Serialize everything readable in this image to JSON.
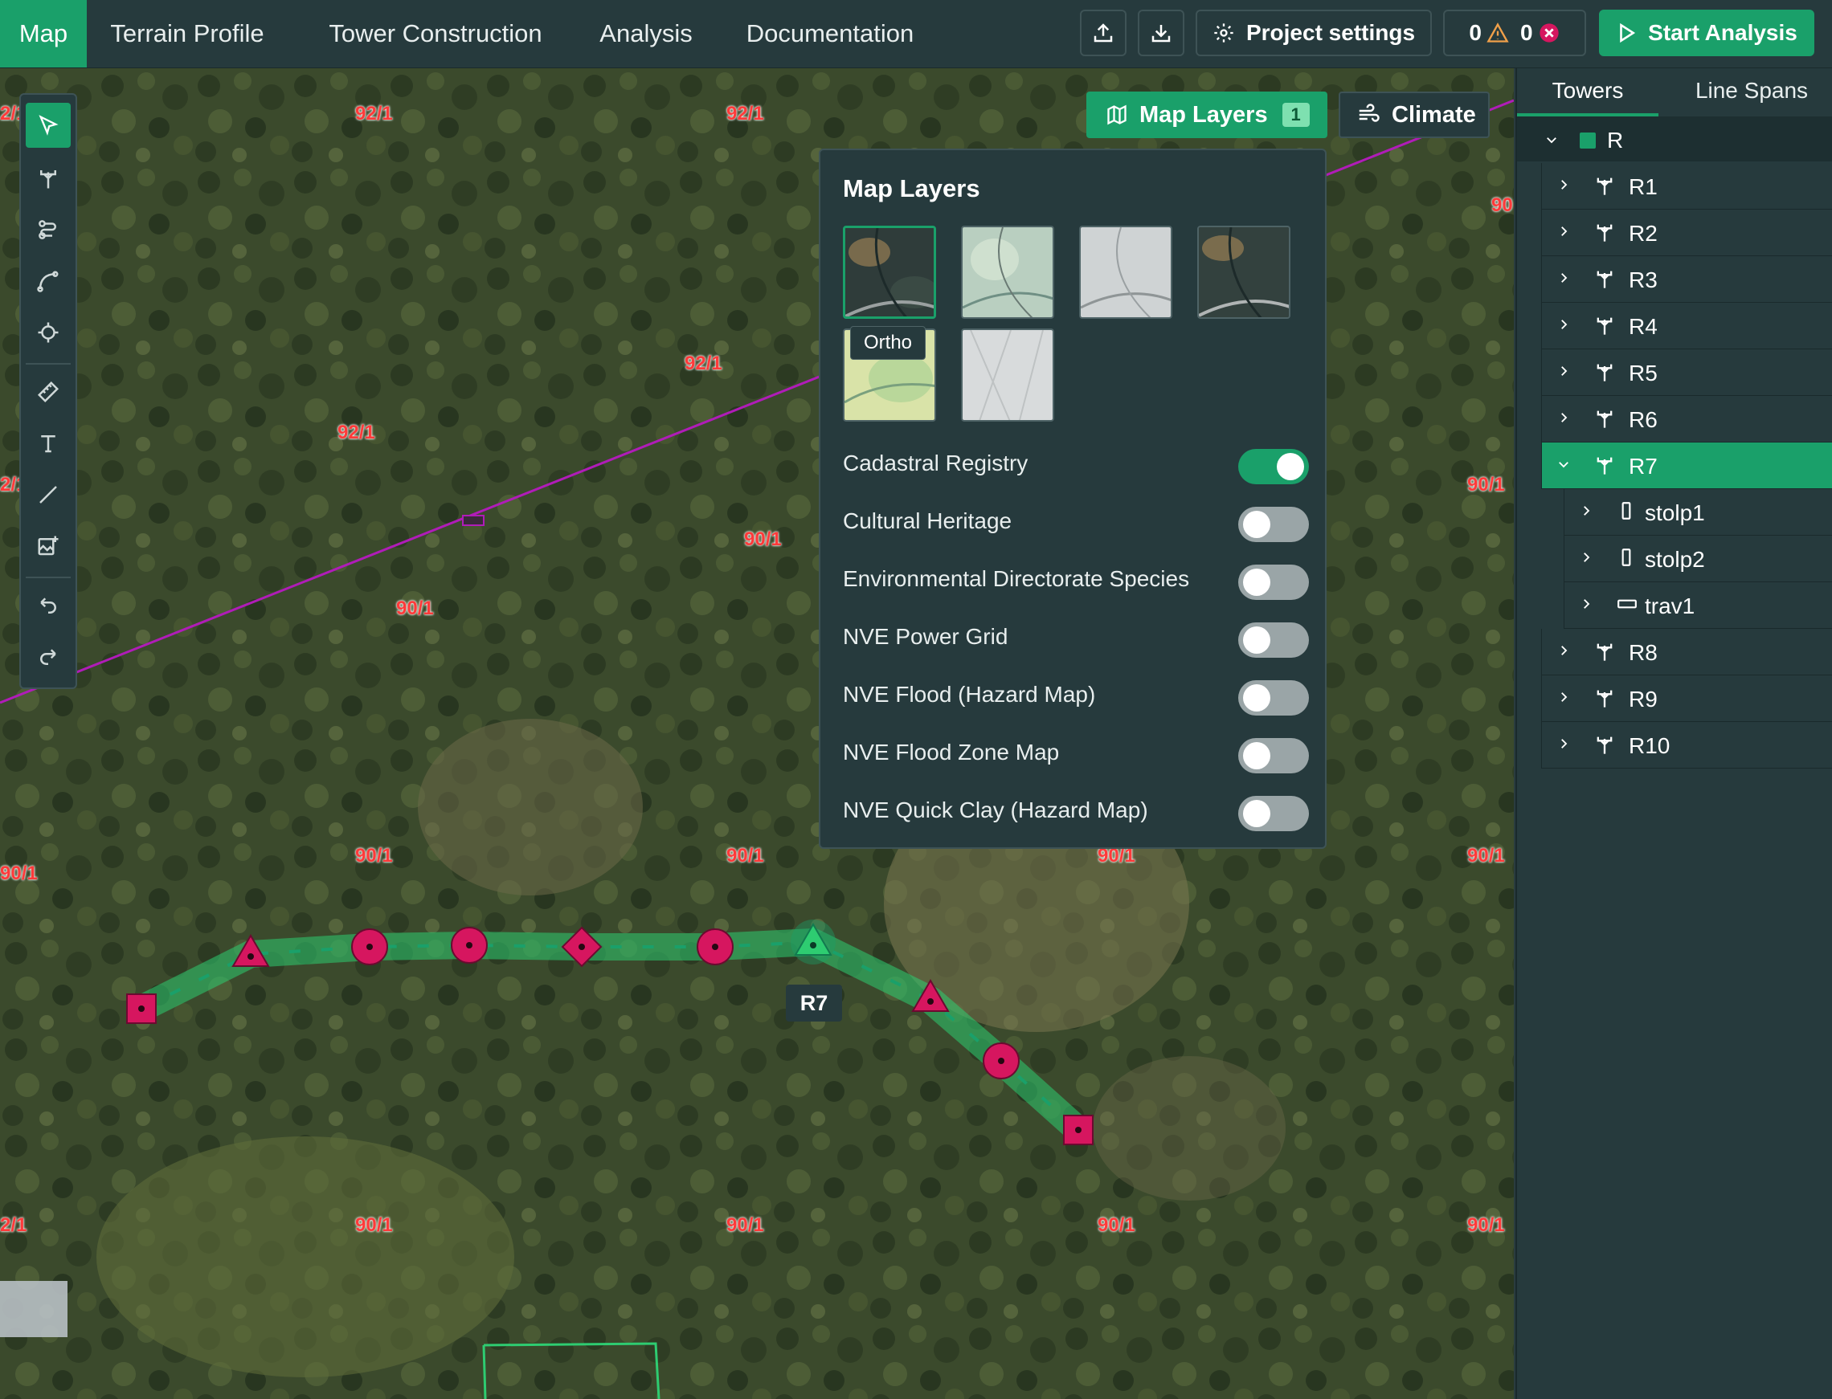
{
  "nav": {
    "tabs": [
      {
        "label": "Map",
        "active": true
      },
      {
        "label": "Terrain Profile",
        "active": false
      },
      {
        "label": "Tower Construction",
        "active": false
      },
      {
        "label": "Analysis",
        "active": false
      },
      {
        "label": "Documentation",
        "active": false
      }
    ]
  },
  "toolbar": {
    "upload_icon": "upload-icon",
    "download_icon": "download-icon",
    "project_settings_label": "Project settings",
    "warnings_count": "0",
    "errors_count": "0",
    "start_analysis_label": "Start Analysis"
  },
  "map_controls": {
    "layers_label": "Map Layers",
    "layers_badge": "1",
    "climate_label": "Climate"
  },
  "layers_panel": {
    "title": "Map Layers",
    "hover_tooltip": "Ortho",
    "layers": [
      {
        "label": "Cadastral Registry",
        "enabled": true
      },
      {
        "label": "Cultural Heritage",
        "enabled": false
      },
      {
        "label": "Environmental Directorate Species",
        "enabled": false
      },
      {
        "label": "NVE Power Grid",
        "enabled": false
      },
      {
        "label": "NVE Flood (Hazard Map)",
        "enabled": false
      },
      {
        "label": "NVE Flood Zone Map",
        "enabled": false
      },
      {
        "label": "NVE Quick Clay (Hazard Map)",
        "enabled": false
      }
    ]
  },
  "map": {
    "parcel_labels": [
      "92/1",
      "92/1",
      "92/1",
      "92/1",
      "90/1",
      "90/1",
      "90/1",
      "90/1",
      "90/1",
      "90/1",
      "90/1",
      "90/1",
      "90/1",
      "90/1",
      "90/1",
      "90/1",
      "90/1",
      "90/1",
      "90/1",
      "90/1"
    ],
    "edge_labels": [
      "2/1",
      "2/1",
      "90/1",
      "90",
      "90/1"
    ],
    "selected_tower_label": "R7"
  },
  "right_panel": {
    "tabs": [
      {
        "label": "Towers",
        "active": true
      },
      {
        "label": "Line Spans",
        "active": false
      }
    ],
    "root": {
      "label": "R",
      "color": "#1aa06a"
    },
    "towers": [
      {
        "label": "R1"
      },
      {
        "label": "R2"
      },
      {
        "label": "R3"
      },
      {
        "label": "R4"
      },
      {
        "label": "R5"
      },
      {
        "label": "R6"
      },
      {
        "label": "R7",
        "selected": true,
        "children": [
          {
            "label": "stolp1",
            "icon": "pole-icon"
          },
          {
            "label": "stolp2",
            "icon": "pole-icon"
          },
          {
            "label": "trav1",
            "icon": "crossarm-icon"
          }
        ]
      },
      {
        "label": "R8"
      },
      {
        "label": "R9"
      },
      {
        "label": "R10"
      }
    ]
  },
  "colors": {
    "accent": "#1aa06a",
    "panel_bg": "#263a3d",
    "marker": "#d6165f",
    "parcel_label": "#ff3a3a",
    "power_line": "#b01cb8"
  }
}
